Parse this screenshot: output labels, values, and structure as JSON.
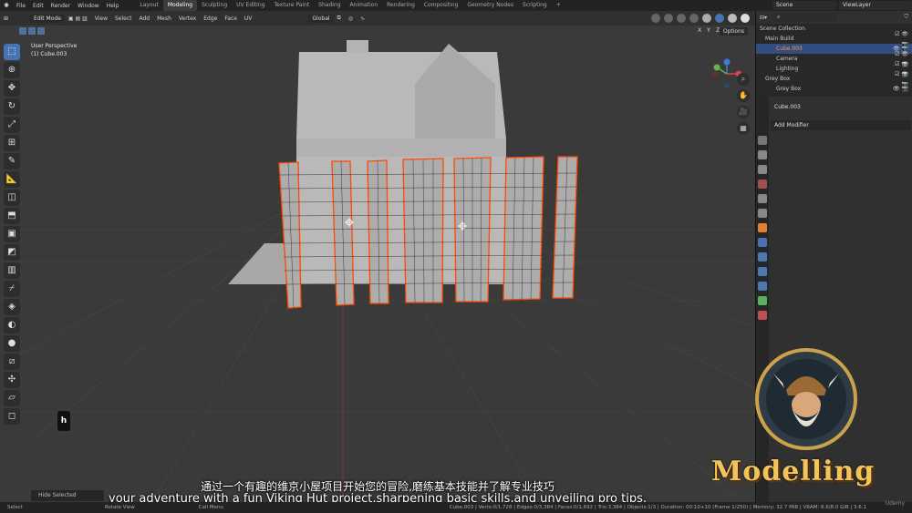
{
  "topbar": {
    "menus": [
      "File",
      "Edit",
      "Render",
      "Window",
      "Help"
    ],
    "workspaces": [
      "Layout",
      "Modeling",
      "Sculpting",
      "UV Editing",
      "Texture Paint",
      "Shading",
      "Animation",
      "Rendering",
      "Compositing",
      "Geometry Nodes",
      "Scripting"
    ],
    "add_tab": "+",
    "scene": "Scene",
    "view_layer": "ViewLayer"
  },
  "viewport": {
    "mode": "Edit Mode",
    "menus": [
      "View",
      "Select",
      "Add",
      "Mesh",
      "Vertex",
      "Edge",
      "Face",
      "UV"
    ],
    "transform": "Global",
    "info_line1": "User Perspective",
    "info_line2": "(1) Cube.003",
    "options": "Options",
    "axes": [
      "X",
      "Y",
      "Z"
    ],
    "hide_selected": "Hide Selected",
    "keycap": "h"
  },
  "subtitles": {
    "cn": "通过一个有趣的维京小屋项目开始您的冒险,磨练基本技能并了解专业技巧",
    "en": "your adventure with a fun Viking Hut project,sharpening basic skills,and unveiling pro tips,"
  },
  "outliner": {
    "rows": [
      {
        "name": "Scene Collection",
        "vis": ""
      },
      {
        "name": "Main Build",
        "vis": "☑ 👁 📷"
      },
      {
        "name": "Cube.003",
        "vis": "👁 📷"
      },
      {
        "name": "Camera",
        "vis": "☑ 👁 📷"
      },
      {
        "name": "Lighting",
        "vis": "☑ 👁 📷"
      },
      {
        "name": "Grey Box",
        "vis": "☑ 👁 📷"
      },
      {
        "name": "Grey Box",
        "vis": "👁 📷"
      }
    ]
  },
  "properties": {
    "object": "Cube.003",
    "add_modifier": "Add Modifier"
  },
  "statusbar": {
    "select": "Select",
    "rotate": "Rotate View",
    "menu": "Call Menu",
    "stats": "Cube.003 | Verts:0/1,728 | Edges:0/3,384 | Faces:0/1,692 | Tris:3,384 | Objects:1/3 | Duration: 00:10+10 (Frame 1/250) | Memory: 32.7 MiB | VRAM: 6.6/8.0 GiB | 3.6.1"
  },
  "branding": {
    "title": "Modelling",
    "watermark": "Udemy"
  },
  "colors": {
    "accent": "#4772b3",
    "selection": "#ff4a00",
    "viewport_bg": "#3a3a3a",
    "grid": "#4a4a4a",
    "mesh_grey": "#b9b9b9",
    "title_gold": "#f2c55c"
  }
}
